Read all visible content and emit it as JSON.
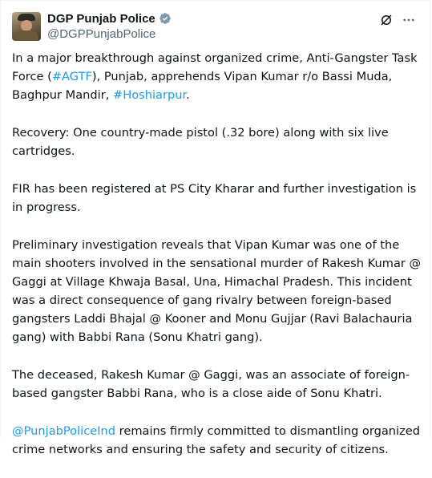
{
  "author": {
    "display_name": "DGP Punjab Police",
    "handle": "@DGPPunjabPolice",
    "verified": true
  },
  "icons": {
    "avatar": "profile-photo",
    "verified": "verified-badge-icon",
    "grok": "grok-icon",
    "more": "more-options-icon"
  },
  "colors": {
    "link": "#1d9bf0",
    "text": "#0f1419",
    "secondary": "#536471",
    "verified_badge": "#829aab"
  },
  "post": {
    "p1": {
      "t1": "In a major breakthrough against organized crime, Anti-Gangster Task Force (",
      "tag_agtf": "#AGTF",
      "t2": "), Punjab, apprehends Vipan Kumar r/o Bassi Muda, Baghpur Mandir, ",
      "tag_hoshiarpur": "#Hoshiarpur",
      "t3": "."
    },
    "p2": "Recovery: One country-made pistol (.32 bore) along with six live cartridges.",
    "p3": "FIR has been registered at PS City Kharar and further investigation is in progress.",
    "p4": "Preliminary investigation reveals that Vipan Kumar was one of the main shooters involved in the sensational murder of Rakesh Kumar @ Gaggi at Village Khwaja Basal, Una, Himachal Pradesh. This incident was a direct consequence of gang rivalry between foreign-based gangsters Laddi Bhajal @ Kooner and Monu Gujjar (Ravi Balachauria gang) with Babbi Rana (Sonu Khatri gang).",
    "p5": "The deceased, Rakesh Kumar @ Gaggi, was an associate of foreign-based gangster Babbi Rana, who is a close aide of Sonu Khatri.",
    "p6": {
      "mention": "@PunjabPoliceInd",
      "t1": " remains firmly committed to dismantling organized crime networks and ensuring the safety and security of citizens."
    }
  }
}
